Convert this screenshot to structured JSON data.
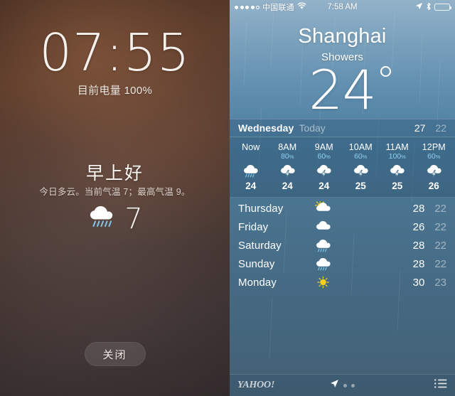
{
  "lockscreen": {
    "clock": "07:55",
    "battery_text": "目前电量 100%",
    "greeting": "早上好",
    "summary": "今日多云。当前气温 7；最高气温 9。",
    "current_temp": "7",
    "current_icon": "rain-cloud-icon",
    "dismiss_label": "关闭"
  },
  "weather": {
    "statusbar": {
      "signal_dots_filled": 4,
      "signal_dots_total": 5,
      "carrier": "中国联通",
      "wifi_icon": "wifi-icon",
      "time": "7:58 AM",
      "location_icon": "location-arrow-icon",
      "bluetooth_icon": "bluetooth-icon",
      "battery_icon": "battery-full-icon"
    },
    "hero": {
      "city": "Shanghai",
      "condition": "Showers",
      "temperature": "24",
      "degree_symbol": "°"
    },
    "today": {
      "day": "Wednesday",
      "label": "Today",
      "high": "27",
      "low": "22"
    },
    "hourly": [
      {
        "time": "Now",
        "pop": "",
        "icon": "rain-cloud-icon",
        "temp": "24"
      },
      {
        "time": "8AM",
        "pop": "80",
        "icon": "thunderstorm-icon",
        "temp": "24"
      },
      {
        "time": "9AM",
        "pop": "60",
        "icon": "thunderstorm-icon",
        "temp": "24"
      },
      {
        "time": "10AM",
        "pop": "60",
        "icon": "thunderstorm-icon",
        "temp": "25"
      },
      {
        "time": "11AM",
        "pop": "100",
        "icon": "thunderstorm-icon",
        "temp": "25"
      },
      {
        "time": "12PM",
        "pop": "60",
        "icon": "thunderstorm-icon",
        "temp": "26"
      }
    ],
    "pop_unit": "%",
    "daily": [
      {
        "day": "Thursday",
        "icon": "sun-behind-cloud-icon",
        "high": "28",
        "low": "22"
      },
      {
        "day": "Friday",
        "icon": "cloud-icon",
        "high": "26",
        "low": "22"
      },
      {
        "day": "Saturday",
        "icon": "rain-cloud-icon",
        "high": "28",
        "low": "22"
      },
      {
        "day": "Sunday",
        "icon": "rain-cloud-icon",
        "high": "28",
        "low": "22"
      },
      {
        "day": "Monday",
        "icon": "sun-icon",
        "high": "30",
        "low": "23"
      }
    ],
    "tabbar": {
      "brand": "YAHOO!",
      "location_icon": "location-arrow-icon",
      "page_dots": 2,
      "list_icon": "list-icon"
    }
  },
  "colors": {
    "accent_blue": "#8fd0f0",
    "panel_blue": "#4a7490",
    "lock_brown": "#5d4033",
    "text_white": "#ffffff",
    "text_muted": "rgba(255,255,255,0.48)"
  }
}
